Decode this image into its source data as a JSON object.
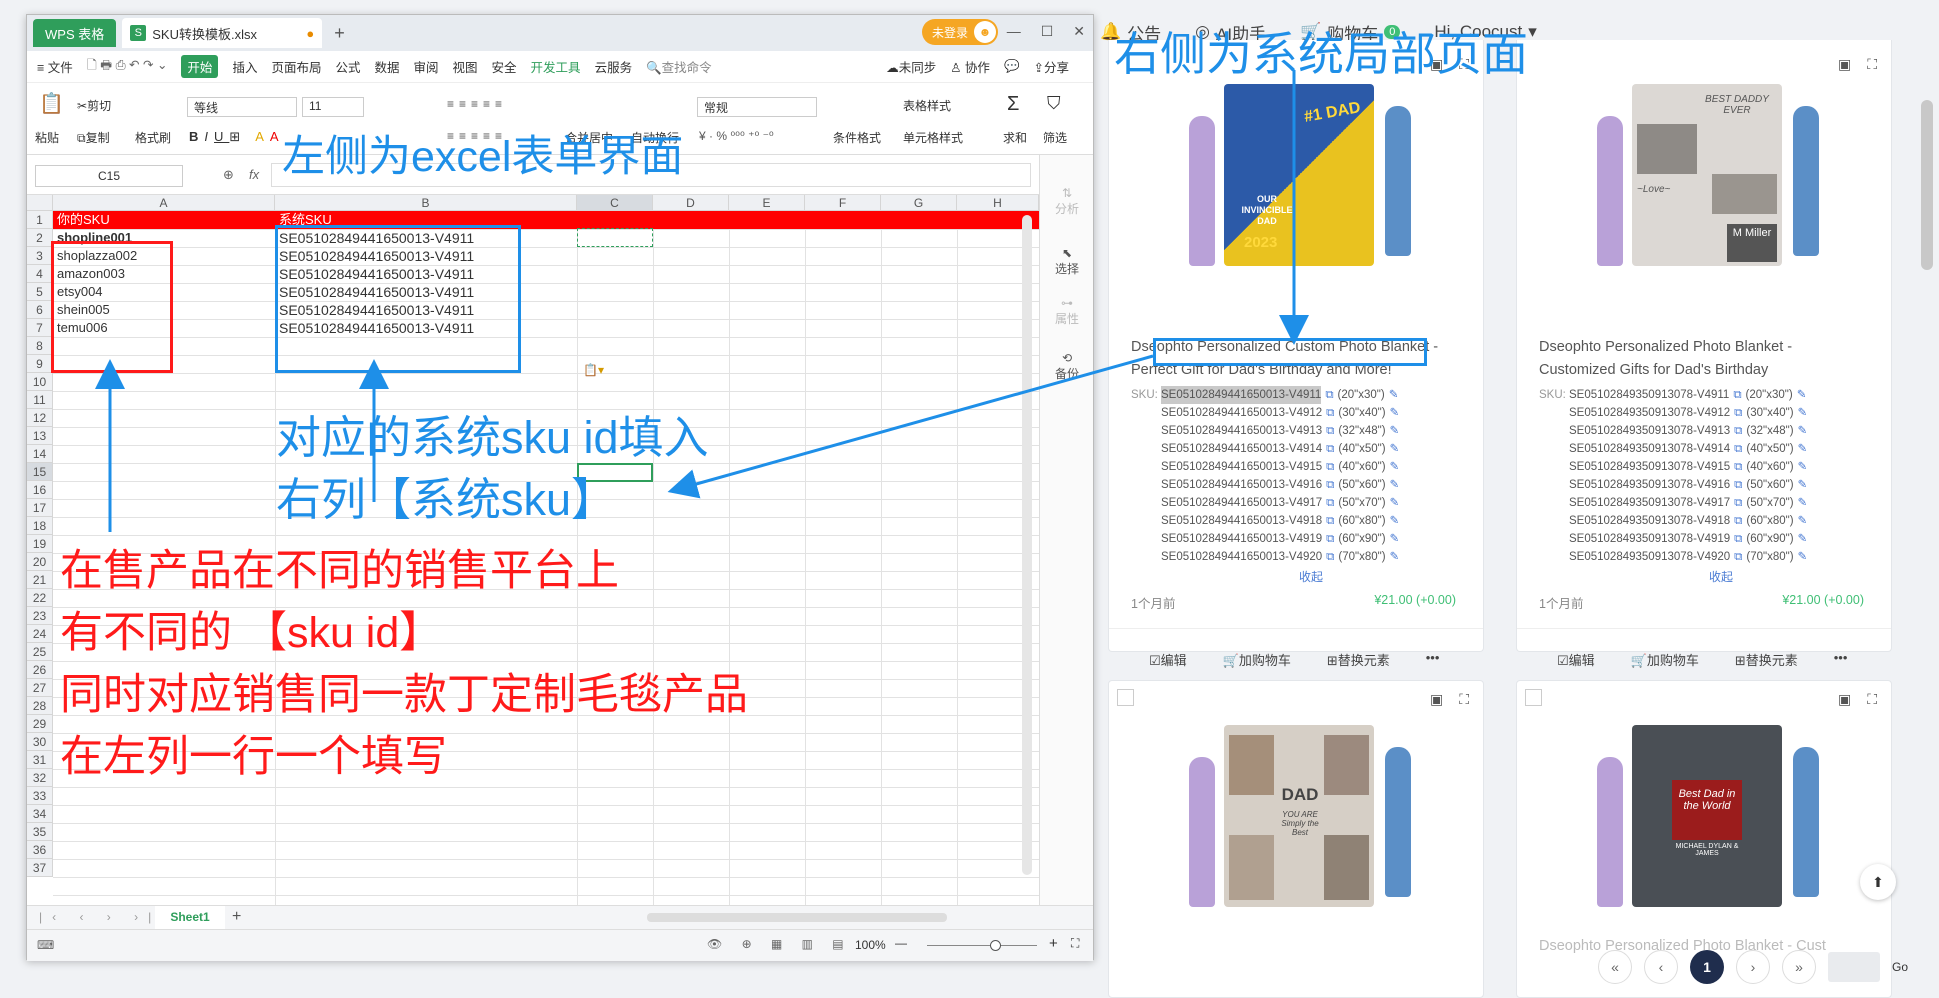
{
  "web": {
    "topnav": [
      {
        "icon": "bell-icon",
        "label": "公告"
      },
      {
        "icon": "robot-icon",
        "label": "AI助手"
      },
      {
        "icon": "cart-icon",
        "label": "购物车",
        "badge": "0"
      },
      {
        "icon": "",
        "label": "Hi, Coocust"
      }
    ],
    "cards": [
      {
        "title": "Dseophto Personalized Custom Photo Blanket - Perfect Gift for Dad's Birthday and More!",
        "sku_label": "SKU:",
        "skus": [
          {
            "code": "SE05102849441650013-V4911",
            "size": "(20\"x30\")"
          },
          {
            "code": "SE05102849441650013-V4912",
            "size": "(30\"x40\")"
          },
          {
            "code": "SE05102849441650013-V4913",
            "size": "(32\"x48\")"
          },
          {
            "code": "SE05102849441650013-V4914",
            "size": "(40\"x50\")"
          },
          {
            "code": "SE05102849441650013-V4915",
            "size": "(40\"x60\")"
          },
          {
            "code": "SE05102849441650013-V4916",
            "size": "(50\"x60\")"
          },
          {
            "code": "SE05102849441650013-V4917",
            "size": "(50\"x70\")"
          },
          {
            "code": "SE05102849441650013-V4918",
            "size": "(60\"x80\")"
          },
          {
            "code": "SE05102849441650013-V4919",
            "size": "(60\"x90\")"
          },
          {
            "code": "SE05102849441650013-V4920",
            "size": "(70\"x80\")"
          }
        ],
        "collapse": "收起",
        "time": "1个月前",
        "price": "¥21.00 (+0.00)",
        "actions": [
          "☑编辑",
          "🛒加购物车",
          "⊞替换元素",
          "•••"
        ],
        "blanket_text": [
          "#1 DAD",
          "OUR INVINCIBLE DAD",
          "2023"
        ]
      },
      {
        "title": "Dseophto Personalized Photo Blanket - Customized Gifts for Dad's Birthday",
        "sku_label": "SKU:",
        "skus": [
          {
            "code": "SE05102849350913078-V4911",
            "size": "(20\"x30\")"
          },
          {
            "code": "SE05102849350913078-V4912",
            "size": "(30\"x40\")"
          },
          {
            "code": "SE05102849350913078-V4913",
            "size": "(32\"x48\")"
          },
          {
            "code": "SE05102849350913078-V4914",
            "size": "(40\"x50\")"
          },
          {
            "code": "SE05102849350913078-V4915",
            "size": "(40\"x60\")"
          },
          {
            "code": "SE05102849350913078-V4916",
            "size": "(50\"x60\")"
          },
          {
            "code": "SE05102849350913078-V4917",
            "size": "(50\"x70\")"
          },
          {
            "code": "SE05102849350913078-V4918",
            "size": "(60\"x80\")"
          },
          {
            "code": "SE05102849350913078-V4919",
            "size": "(60\"x90\")"
          },
          {
            "code": "SE05102849350913078-V4920",
            "size": "(70\"x80\")"
          }
        ],
        "collapse": "收起",
        "time": "1个月前",
        "price": "¥21.00 (+0.00)",
        "actions": [
          "☑编辑",
          "🛒加购物车",
          "⊞替换元素",
          "•••"
        ],
        "blanket_text": [
          "BEST DADDY EVER",
          "~Love~",
          "M Miller"
        ]
      },
      {
        "blanket_text": [
          "DAD",
          "YOU ARE Simply the Best"
        ],
        "title": ""
      },
      {
        "blanket_text": [
          "Best Dad in the World",
          "MICHAEL DYLAN & JAMES"
        ],
        "title": "Dseophto Personalized Photo Blanket - Cust"
      }
    ],
    "pager": {
      "first": "«",
      "prev": "‹",
      "current": "1",
      "next": "›",
      "last": "»",
      "go": "Go"
    }
  },
  "excel": {
    "wps_tab": "WPS 表格",
    "file_tab": "SKU转换模板.xlsx",
    "login": "未登录",
    "menus": [
      "≡ 文件",
      "开始",
      "插入",
      "页面布局",
      "公式",
      "数据",
      "审阅",
      "视图",
      "安全",
      "开发工具",
      "云服务",
      "🔍查找命令"
    ],
    "menu_right": [
      "☁未同步",
      "♙ 协作",
      "💬",
      "⇪分享"
    ],
    "ribbon": {
      "paste": "粘贴",
      "cut": "剪切",
      "copy": "复制",
      "format_painter": "格式刷",
      "font": "等线",
      "size": "11",
      "merge": "合并居中",
      "wrap": "自动换行",
      "numfmt": "常规",
      "cond": "条件格式",
      "table_style": "表格样式",
      "cell_style": "单元格样式",
      "sum": "求和",
      "filter": "筛选"
    },
    "namebox": "C15",
    "fx": "fx",
    "columns": [
      "A",
      "B",
      "C",
      "D",
      "E",
      "F",
      "G",
      "H"
    ],
    "rows": [
      "1",
      "2",
      "3",
      "4",
      "5",
      "6",
      "7",
      "8",
      "9",
      "10",
      "11",
      "12",
      "13",
      "14",
      "15",
      "16",
      "17",
      "18",
      "19",
      "20",
      "21",
      "22",
      "23",
      "24",
      "25",
      "26",
      "27",
      "28",
      "29",
      "30",
      "31",
      "32",
      "33",
      "34",
      "35",
      "36",
      "37"
    ],
    "header_a": "你的SKU",
    "header_b": "系统SKU",
    "col_a": [
      "shopline001",
      "shoplazza002",
      "amazon003",
      "etsy004",
      "shein005",
      "temu006"
    ],
    "col_b": [
      "SE05102849441650013-V4911",
      "SE05102849441650013-V4911",
      "SE05102849441650013-V4911",
      "SE05102849441650013-V4911",
      "SE05102849441650013-V4911",
      "SE05102849441650013-V4911"
    ],
    "side": [
      "分析",
      "选择",
      "属性",
      "备份"
    ],
    "sheet": "Sheet1",
    "zoom": "100%"
  },
  "annotations": {
    "right_title": "右侧为系统局部页面",
    "left_title": "左侧为excel表单界面",
    "blue_note": [
      "对应的系统sku id填入",
      "右列【系统sku】"
    ],
    "red_note": [
      "在售产品在不同的销售平台上",
      "有不同的 【sku id】",
      "同时对应销售同一款丁定制毛毯产品",
      "在左列一行一个填写"
    ]
  },
  "colors": {
    "excel_green": "#2f9e5b",
    "annot_red": "#ff1a1a",
    "annot_blue": "#1e8fe8",
    "price_green": "#3fbf75"
  }
}
